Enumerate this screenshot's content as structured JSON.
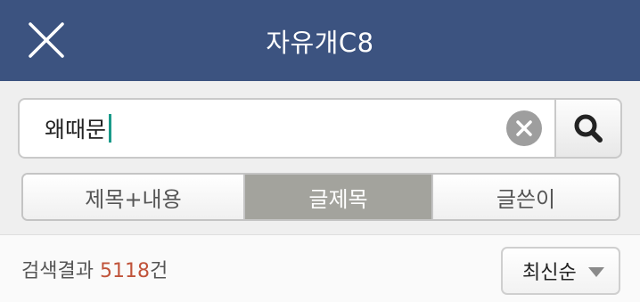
{
  "header": {
    "title": "자유개C8"
  },
  "search": {
    "value": "왜때문"
  },
  "tabs": [
    {
      "label": "제목+내용",
      "active": false
    },
    {
      "label": "글제목",
      "active": true
    },
    {
      "label": "글쓴이",
      "active": false
    }
  ],
  "results": {
    "prefix": "검색결과 ",
    "count": "5118",
    "suffix": "건"
  },
  "sort": {
    "selected": "최신순"
  },
  "colors": {
    "header_bg": "#3c5380",
    "active_tab_bg": "#a3a39d",
    "count_color": "#c0533a",
    "caret_color": "#1a9a8a"
  },
  "icons": {
    "close": "close-icon",
    "clear": "clear-icon",
    "search": "search-icon",
    "sort_dropdown": "chevron-down-icon"
  }
}
